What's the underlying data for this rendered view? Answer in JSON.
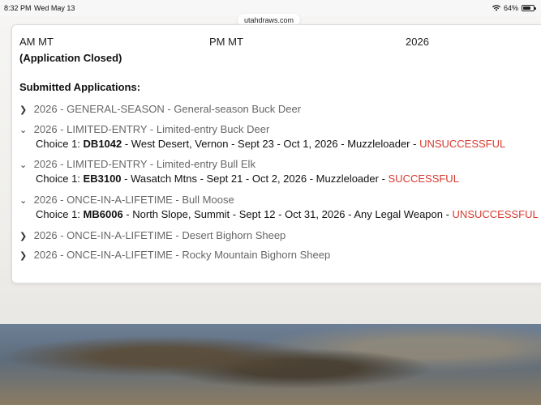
{
  "status_bar": {
    "time": "8:32 PM",
    "date": "Wed May 13",
    "battery": "64%"
  },
  "browser": {
    "url": "utahdraws.com"
  },
  "top_fragments": {
    "left": "AM MT",
    "middle": "PM MT",
    "right": "2026"
  },
  "application_status": "(Application Closed)",
  "submitted_heading": "Submitted Applications:",
  "applications": [
    {
      "expanded": false,
      "title": "2026 - GENERAL-SEASON - General-season Buck Deer"
    },
    {
      "expanded": true,
      "title": "2026 - LIMITED-ENTRY - Limited-entry Buck Deer",
      "choice_prefix": "Choice 1: ",
      "hunt_code": "DB1042",
      "details": " - West Desert, Vernon - Sept 23 - Oct 1, 2026 - Muzzleloader - ",
      "result": "UNSUCCESSFUL"
    },
    {
      "expanded": true,
      "title": "2026 - LIMITED-ENTRY - Limited-entry Bull Elk",
      "choice_prefix": "Choice 1: ",
      "hunt_code": "EB3100",
      "details": " - Wasatch Mtns - Sept 21 - Oct 2, 2026 - Muzzleloader - ",
      "result": "SUCCESSFUL"
    },
    {
      "expanded": true,
      "title": "2026 - ONCE-IN-A-LIFETIME - Bull Moose",
      "choice_prefix": "Choice 1: ",
      "hunt_code": "MB6006",
      "details": " - North Slope, Summit - Sept 12 - Oct 31, 2026 - Any Legal Weapon - ",
      "result": "UNSUCCESSFUL"
    },
    {
      "expanded": false,
      "title": "2026 - ONCE-IN-A-LIFETIME - Desert Bighorn Sheep"
    },
    {
      "expanded": false,
      "title": "2026 - ONCE-IN-A-LIFETIME - Rocky Mountain Bighorn Sheep"
    }
  ],
  "colors": {
    "result_red": "#d63a2f",
    "title_gray": "#666666"
  }
}
